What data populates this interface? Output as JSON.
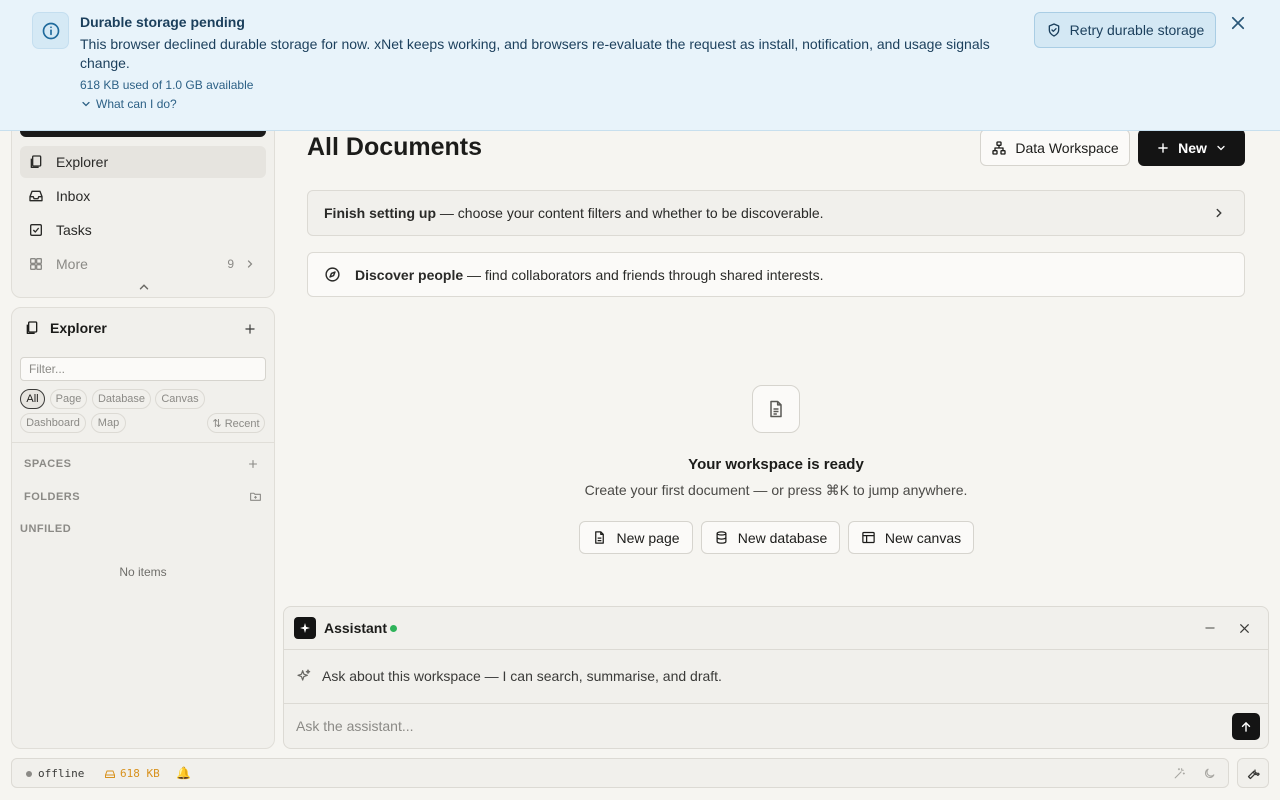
{
  "banner": {
    "title": "Durable storage pending",
    "message": "This browser declined durable storage for now. xNet keeps working, and browsers re-evaluate the request as install, notification, and usage signals change.",
    "usage": "618 KB used of 1.0 GB available",
    "what_can_i_do": "What can I do?",
    "retry_label": "Retry durable storage",
    "icons": {
      "info": "info-icon",
      "retry": "shield-check-icon",
      "close": "close-icon"
    }
  },
  "nav": {
    "items": [
      {
        "label": "Explorer",
        "icon": "documents-icon",
        "active": true
      },
      {
        "label": "Inbox",
        "icon": "inbox-icon"
      },
      {
        "label": "Tasks",
        "icon": "checkbox-icon"
      },
      {
        "label": "More",
        "icon": "grid-icon",
        "count": "9"
      }
    ]
  },
  "explorer": {
    "title": "Explorer",
    "filter_placeholder": "Filter...",
    "chips": [
      "All",
      "Page",
      "Database",
      "Canvas",
      "Dashboard",
      "Map"
    ],
    "active_chip": "All",
    "sort_label": "⇅ Recent",
    "sections": {
      "spaces": "SPACES",
      "folders": "FOLDERS",
      "unfiled": "UNFILED"
    },
    "empty": "No items"
  },
  "main": {
    "title": "All Documents",
    "workspace_button": "Data Workspace",
    "new_button": "New",
    "setup": {
      "bold": "Finish setting up",
      "rest": " — choose your content filters and whether to be discoverable."
    },
    "discover": {
      "bold": "Discover people",
      "rest": " — find collaborators and friends through shared interests."
    },
    "empty_title": "Your workspace is ready",
    "empty_sub": "Create your first document — or press ⌘K to jump anywhere.",
    "actions": {
      "page": "New page",
      "database": "New database",
      "canvas": "New canvas"
    }
  },
  "assistant": {
    "title": "Assistant",
    "status_color": "#2fb35a",
    "hint": "Ask about this workspace — I can search, summarise, and draft.",
    "input_placeholder": "Ask the assistant..."
  },
  "statusbar": {
    "connection": "offline",
    "storage": "618 KB",
    "bell": "🔔"
  },
  "colors": {
    "accent_dark": "#141414",
    "banner_bg": "#e8f3fa",
    "warning": "#d8921e"
  }
}
